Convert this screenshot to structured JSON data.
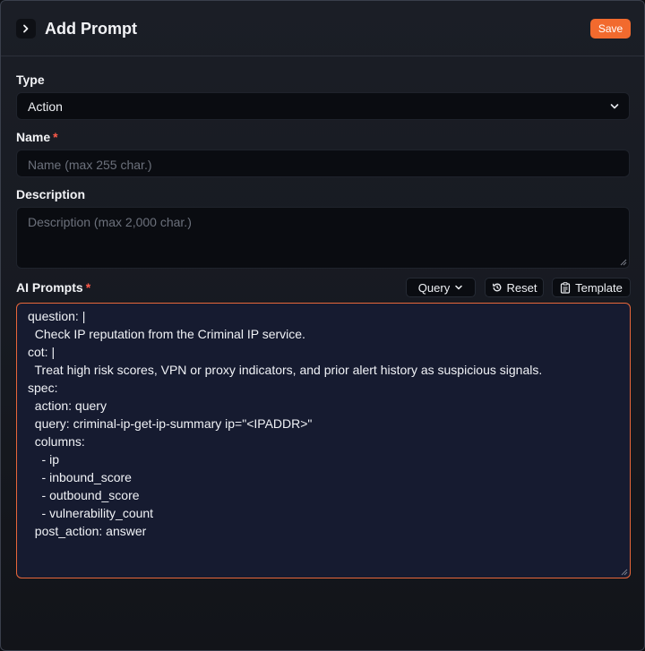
{
  "header": {
    "title": "Add Prompt",
    "save_label": "Save",
    "toggle_icon": "chevron-right-icon"
  },
  "type": {
    "label": "Type",
    "value": "Action"
  },
  "name": {
    "label": "Name",
    "required_mark": "*",
    "placeholder": "Name (max 255 char.)"
  },
  "description": {
    "label": "Description",
    "placeholder": "Description (max 2,000 char.)"
  },
  "ai_prompts": {
    "label": "AI Prompts",
    "required_mark": "*",
    "query_label": "Query",
    "reset_label": "Reset",
    "template_label": "Template",
    "lines": [
      "question: |",
      "  Check IP reputation from the Criminal IP service.",
      "cot: |",
      "  Treat high risk scores, VPN or proxy indicators, and prior alert history as suspicious signals.",
      "spec:",
      "  action: query",
      "  query: criminal-ip-get-ip-summary ip=\"<IPADDR>\"",
      "  columns:",
      "    - ip",
      "    - inbound_score",
      "    - outbound_score",
      "    - vulnerability_count",
      "  post_action: answer"
    ]
  },
  "colors": {
    "accent": "#f26a2e",
    "required": "#ff5a4a",
    "prompt_bg": "#161b30"
  }
}
